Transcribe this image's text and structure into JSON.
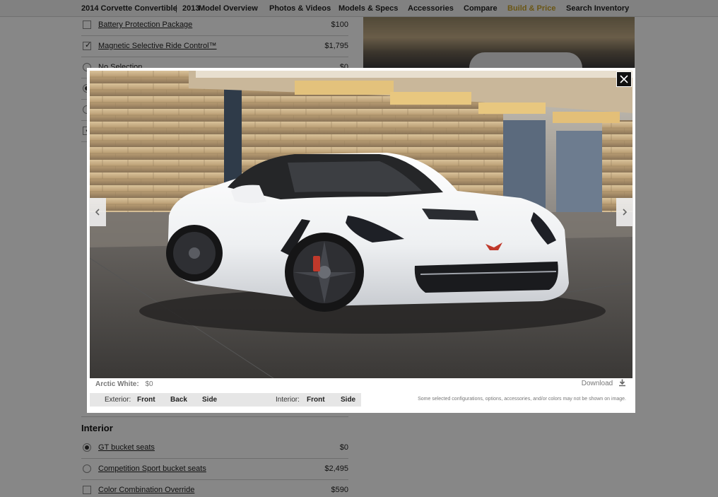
{
  "nav": {
    "model_label": "2014 Corvette Convertible",
    "separator": "|",
    "year_label": "2013",
    "links": [
      "Model Overview",
      "Photos & Videos",
      "Models & Specs",
      "Accessories",
      "Compare",
      "Build & Price",
      "Search Inventory"
    ],
    "active_link": "Build & Price",
    "active_color": "#c9a227"
  },
  "options_top": [
    {
      "control": "checkbox",
      "checked": false,
      "label": "Battery Protection Package",
      "price": "$100"
    },
    {
      "control": "checkbox",
      "checked": true,
      "label": "Magnetic Selective Ride Control™",
      "price": "$1,795"
    },
    {
      "control": "radio",
      "checked": false,
      "label": "No Selection",
      "price": "$0"
    }
  ],
  "interior": {
    "heading": "Interior",
    "options": [
      {
        "control": "radio",
        "checked": true,
        "label": "GT bucket seats",
        "price": "$0"
      },
      {
        "control": "radio",
        "checked": false,
        "label": "Competition Sport bucket seats",
        "price": "$2,495"
      },
      {
        "control": "checkbox",
        "checked": false,
        "label": "Color Combination Override",
        "price": "$590"
      }
    ]
  },
  "lightbox": {
    "color_name": "Arctic White:",
    "color_price": "$0",
    "download_label": "Download",
    "exterior_label": "Exterior:",
    "exterior_views": [
      "Front",
      "Back",
      "Side"
    ],
    "interior_label": "Interior:",
    "interior_views": [
      "Front",
      "Side"
    ],
    "disclaimer": "Some selected configurations, options, accessories, and/or colors may not be shown on image.",
    "car_color": "#f4f5f6"
  }
}
